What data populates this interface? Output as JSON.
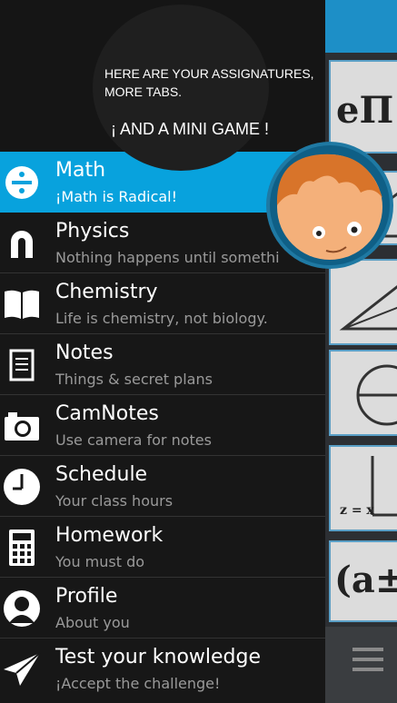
{
  "tooltip": {
    "line1": "HERE ARE YOUR ASSIGNATURES,",
    "line2": "MORE TABS.",
    "line3": "¡ AND A MINI GAME !"
  },
  "menu": {
    "items": [
      {
        "title": "Math",
        "subtitle": "¡Math is Radical!",
        "icon": "divide-icon",
        "active": true
      },
      {
        "title": "Physics",
        "subtitle": "Nothing happens until somethi",
        "icon": "magnet-icon"
      },
      {
        "title": "Chemistry",
        "subtitle": "Life is chemistry, not biology.",
        "icon": "book-icon"
      },
      {
        "title": "Notes",
        "subtitle": "Things & secret plans",
        "icon": "notes-icon"
      },
      {
        "title": "CamNotes",
        "subtitle": "Use camera for notes",
        "icon": "camera-icon"
      },
      {
        "title": "Schedule",
        "subtitle": "Your class hours",
        "icon": "clock-icon"
      },
      {
        "title": "Homework",
        "subtitle": "You must do",
        "icon": "calculator-icon"
      },
      {
        "title": "Profile",
        "subtitle": "About you",
        "icon": "person-icon"
      },
      {
        "title": "Test your knowledge",
        "subtitle": "¡Accept the challenge!",
        "icon": "paper-plane-icon"
      }
    ]
  },
  "background": {
    "card1_text": "eΠ",
    "card5_text": "z = x",
    "card6_text": "(a±"
  },
  "colors": {
    "accent": "#08a2dd",
    "drawer_bg": "#171717",
    "mascot_ring": "#1f79a3",
    "hair": "#d8742a"
  }
}
